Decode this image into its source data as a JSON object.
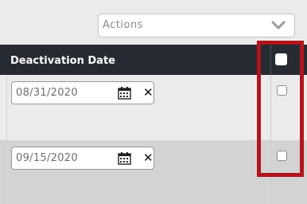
{
  "toolbar": {
    "actions_label": "Actions",
    "dropdown_icon": "chevron-down-icon"
  },
  "table": {
    "header": {
      "deactivation_date_label": "Deactivation Date"
    },
    "rows": [
      {
        "deactivation_date": "08/31/2020",
        "selected": false
      },
      {
        "deactivation_date": "09/15/2020",
        "selected": false
      }
    ]
  },
  "icons": {
    "calendar": "calendar-icon",
    "clear": "clear-x-icon"
  },
  "colors": {
    "header_bg": "#262b33",
    "highlight_border": "#b2141a",
    "row_alt": "#d3d3d3"
  }
}
